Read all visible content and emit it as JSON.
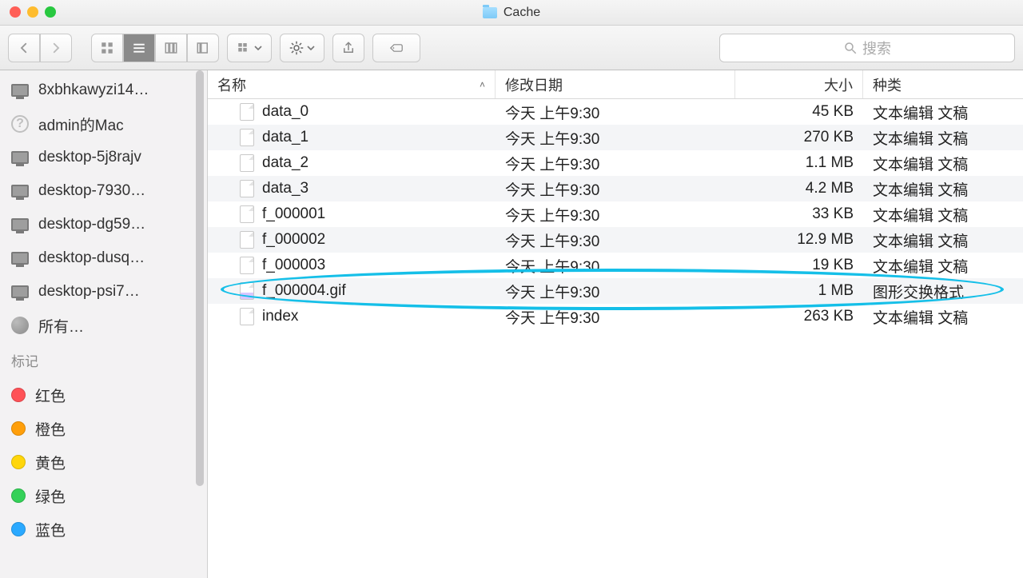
{
  "window": {
    "title": "Cache"
  },
  "toolbar": {
    "search_placeholder": "搜索"
  },
  "sidebar": {
    "devices": [
      {
        "label": "8xbhkawyzi14…",
        "icon": "monitor"
      },
      {
        "label": "admin的Mac",
        "icon": "question"
      },
      {
        "label": "desktop-5j8rajv",
        "icon": "monitor"
      },
      {
        "label": "desktop-7930…",
        "icon": "monitor"
      },
      {
        "label": "desktop-dg59…",
        "icon": "monitor"
      },
      {
        "label": "desktop-dusq…",
        "icon": "monitor"
      },
      {
        "label": "desktop-psi7…",
        "icon": "monitor"
      },
      {
        "label": "所有…",
        "icon": "globe"
      }
    ],
    "tags_header": "标记",
    "tags": [
      {
        "label": "红色",
        "color": "c-red"
      },
      {
        "label": "橙色",
        "color": "c-orange"
      },
      {
        "label": "黄色",
        "color": "c-yellow"
      },
      {
        "label": "绿色",
        "color": "c-green"
      },
      {
        "label": "蓝色",
        "color": "c-blue"
      }
    ]
  },
  "columns": {
    "name": "名称",
    "date": "修改日期",
    "size": "大小",
    "kind": "种类"
  },
  "files": [
    {
      "name": "data_0",
      "date": "今天 上午9:30",
      "size": "45 KB",
      "kind": "文本编辑 文稿",
      "icon": "txt"
    },
    {
      "name": "data_1",
      "date": "今天 上午9:30",
      "size": "270 KB",
      "kind": "文本编辑 文稿",
      "icon": "txt"
    },
    {
      "name": "data_2",
      "date": "今天 上午9:30",
      "size": "1.1 MB",
      "kind": "文本编辑 文稿",
      "icon": "txt"
    },
    {
      "name": "data_3",
      "date": "今天 上午9:30",
      "size": "4.2 MB",
      "kind": "文本编辑 文稿",
      "icon": "txt"
    },
    {
      "name": "f_000001",
      "date": "今天 上午9:30",
      "size": "33 KB",
      "kind": "文本编辑 文稿",
      "icon": "txt"
    },
    {
      "name": "f_000002",
      "date": "今天 上午9:30",
      "size": "12.9 MB",
      "kind": "文本编辑 文稿",
      "icon": "txt"
    },
    {
      "name": "f_000003",
      "date": "今天 上午9:30",
      "size": "19 KB",
      "kind": "文本编辑 文稿",
      "icon": "txt"
    },
    {
      "name": "f_000004.gif",
      "date": "今天 上午9:30",
      "size": "1 MB",
      "kind": "图形交换格式",
      "icon": "gif"
    },
    {
      "name": "index",
      "date": "今天 上午9:30",
      "size": "263 KB",
      "kind": "文本编辑 文稿",
      "icon": "txt"
    }
  ],
  "annotation": {
    "highlight_file_index": 7
  }
}
